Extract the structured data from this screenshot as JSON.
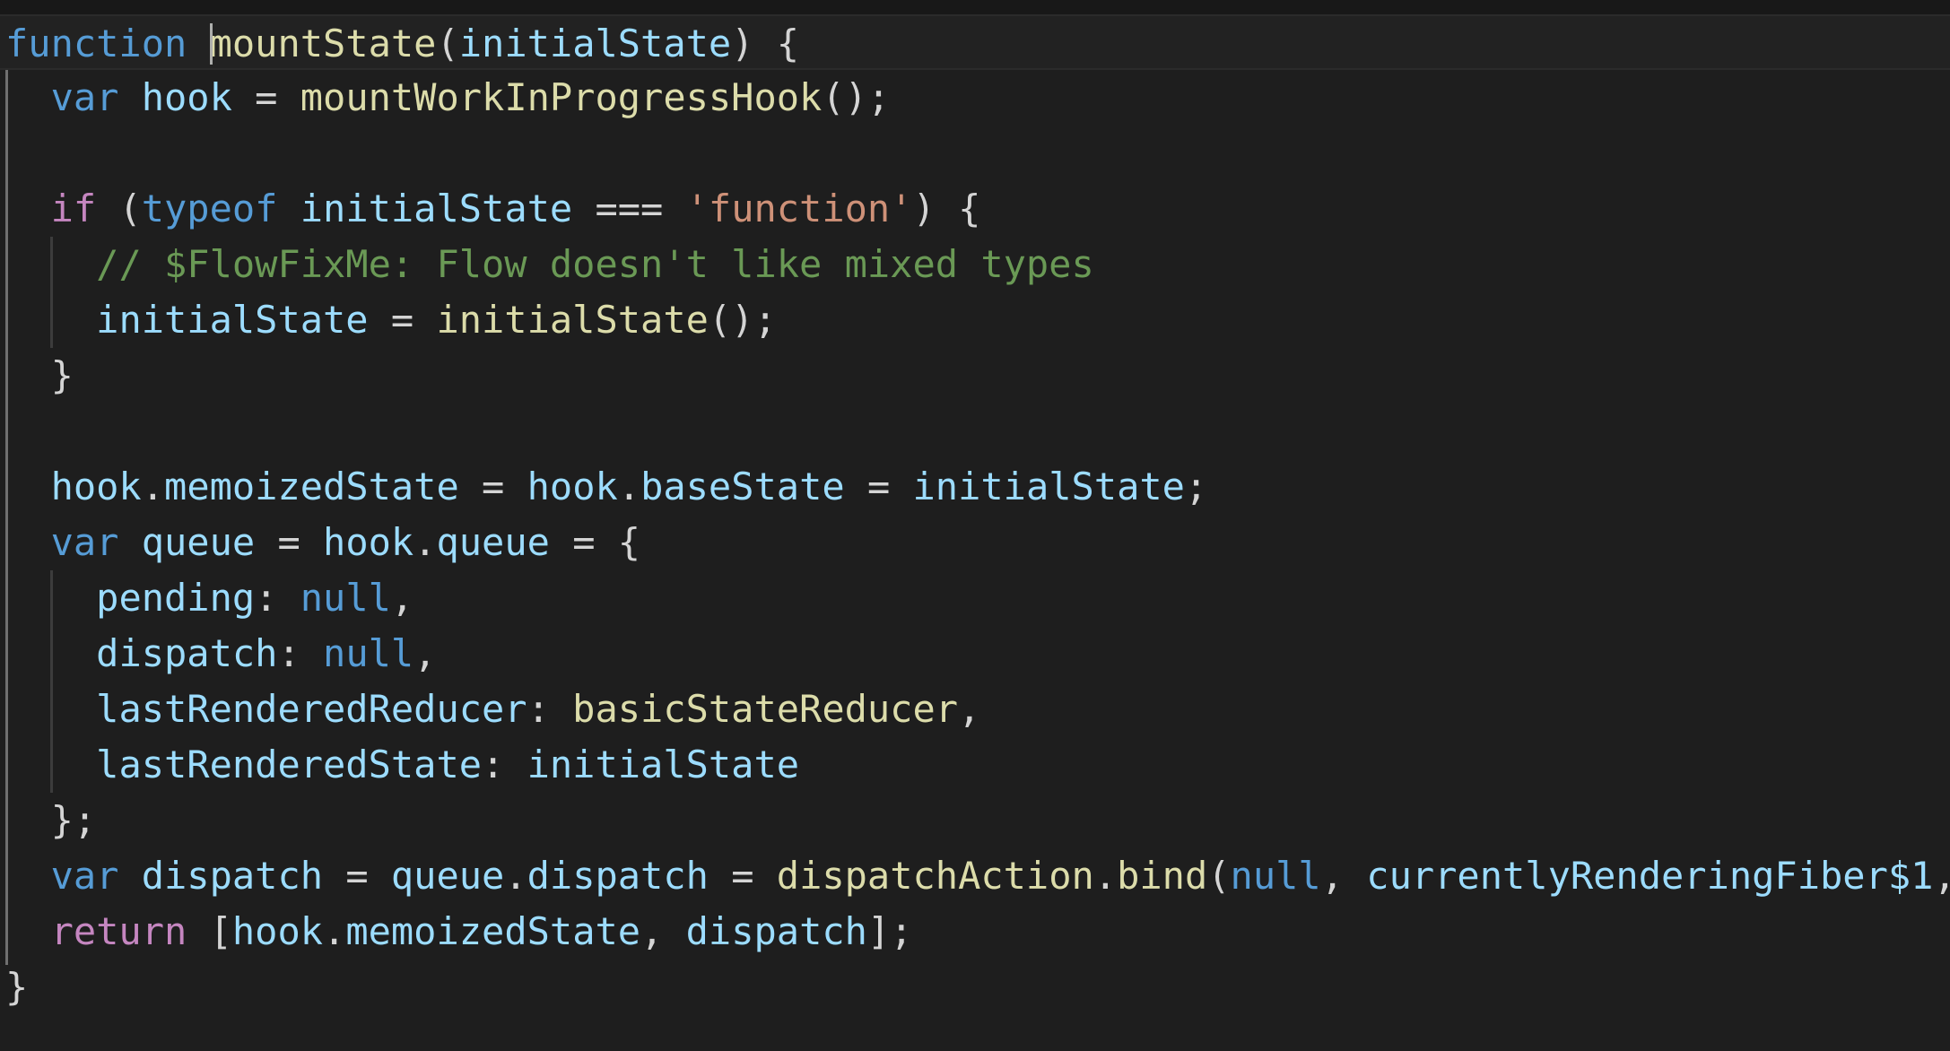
{
  "editor": {
    "theme_colors": {
      "background": "#1e1e1e",
      "keyword": "#569cd6",
      "control": "#c586c0",
      "function": "#dcdcaa",
      "variable": "#9cdcfe",
      "string": "#ce9178",
      "comment": "#6a9955",
      "punctuation": "#d4d4d4"
    },
    "lines": [
      {
        "tokens": [
          {
            "t": "function",
            "c": "kw"
          },
          {
            "t": " ",
            "c": "pun"
          },
          {
            "t": "",
            "c": "cursor"
          },
          {
            "t": "mountState",
            "c": "fn"
          },
          {
            "t": "(",
            "c": "pun"
          },
          {
            "t": "initialState",
            "c": "var"
          },
          {
            "t": ") {",
            "c": "pun"
          }
        ]
      },
      {
        "tokens": [
          {
            "t": "  ",
            "c": "pun"
          },
          {
            "t": "var",
            "c": "kw"
          },
          {
            "t": " ",
            "c": "pun"
          },
          {
            "t": "hook",
            "c": "var"
          },
          {
            "t": " = ",
            "c": "pun"
          },
          {
            "t": "mountWorkInProgressHook",
            "c": "fn"
          },
          {
            "t": "();",
            "c": "pun"
          }
        ]
      },
      {
        "tokens": []
      },
      {
        "tokens": [
          {
            "t": "  ",
            "c": "pun"
          },
          {
            "t": "if",
            "c": "ctl"
          },
          {
            "t": " (",
            "c": "pun"
          },
          {
            "t": "typeof",
            "c": "kw"
          },
          {
            "t": " ",
            "c": "pun"
          },
          {
            "t": "initialState",
            "c": "var"
          },
          {
            "t": " === ",
            "c": "pun"
          },
          {
            "t": "'function'",
            "c": "str"
          },
          {
            "t": ") {",
            "c": "pun"
          }
        ]
      },
      {
        "tokens": [
          {
            "t": "    ",
            "c": "pun"
          },
          {
            "t": "// $FlowFixMe: Flow doesn't like mixed types",
            "c": "cmt"
          }
        ]
      },
      {
        "tokens": [
          {
            "t": "    ",
            "c": "pun"
          },
          {
            "t": "initialState",
            "c": "var"
          },
          {
            "t": " = ",
            "c": "pun"
          },
          {
            "t": "initialState",
            "c": "fn"
          },
          {
            "t": "();",
            "c": "pun"
          }
        ]
      },
      {
        "tokens": [
          {
            "t": "  }",
            "c": "pun"
          }
        ]
      },
      {
        "tokens": []
      },
      {
        "tokens": [
          {
            "t": "  ",
            "c": "pun"
          },
          {
            "t": "hook",
            "c": "var"
          },
          {
            "t": ".",
            "c": "pun"
          },
          {
            "t": "memoizedState",
            "c": "var"
          },
          {
            "t": " = ",
            "c": "pun"
          },
          {
            "t": "hook",
            "c": "var"
          },
          {
            "t": ".",
            "c": "pun"
          },
          {
            "t": "baseState",
            "c": "var"
          },
          {
            "t": " = ",
            "c": "pun"
          },
          {
            "t": "initialState",
            "c": "var"
          },
          {
            "t": ";",
            "c": "pun"
          }
        ]
      },
      {
        "tokens": [
          {
            "t": "  ",
            "c": "pun"
          },
          {
            "t": "var",
            "c": "kw"
          },
          {
            "t": " ",
            "c": "pun"
          },
          {
            "t": "queue",
            "c": "var"
          },
          {
            "t": " = ",
            "c": "pun"
          },
          {
            "t": "hook",
            "c": "var"
          },
          {
            "t": ".",
            "c": "pun"
          },
          {
            "t": "queue",
            "c": "var"
          },
          {
            "t": " = {",
            "c": "pun"
          }
        ]
      },
      {
        "tokens": [
          {
            "t": "    ",
            "c": "pun"
          },
          {
            "t": "pending",
            "c": "var"
          },
          {
            "t": ": ",
            "c": "pun"
          },
          {
            "t": "null",
            "c": "kw"
          },
          {
            "t": ",",
            "c": "pun"
          }
        ]
      },
      {
        "tokens": [
          {
            "t": "    ",
            "c": "pun"
          },
          {
            "t": "dispatch",
            "c": "var"
          },
          {
            "t": ": ",
            "c": "pun"
          },
          {
            "t": "null",
            "c": "kw"
          },
          {
            "t": ",",
            "c": "pun"
          }
        ]
      },
      {
        "tokens": [
          {
            "t": "    ",
            "c": "pun"
          },
          {
            "t": "lastRenderedReducer",
            "c": "var"
          },
          {
            "t": ": ",
            "c": "pun"
          },
          {
            "t": "basicStateReducer",
            "c": "fn"
          },
          {
            "t": ",",
            "c": "pun"
          }
        ]
      },
      {
        "tokens": [
          {
            "t": "    ",
            "c": "pun"
          },
          {
            "t": "lastRenderedState",
            "c": "var"
          },
          {
            "t": ": ",
            "c": "pun"
          },
          {
            "t": "initialState",
            "c": "var"
          }
        ]
      },
      {
        "tokens": [
          {
            "t": "  };",
            "c": "pun"
          }
        ]
      },
      {
        "tokens": [
          {
            "t": "  ",
            "c": "pun"
          },
          {
            "t": "var",
            "c": "kw"
          },
          {
            "t": " ",
            "c": "pun"
          },
          {
            "t": "dispatch",
            "c": "var"
          },
          {
            "t": " = ",
            "c": "pun"
          },
          {
            "t": "queue",
            "c": "var"
          },
          {
            "t": ".",
            "c": "pun"
          },
          {
            "t": "dispatch",
            "c": "var"
          },
          {
            "t": " = ",
            "c": "pun"
          },
          {
            "t": "dispatchAction",
            "c": "fn"
          },
          {
            "t": ".",
            "c": "pun"
          },
          {
            "t": "bind",
            "c": "fn"
          },
          {
            "t": "(",
            "c": "pun"
          },
          {
            "t": "null",
            "c": "kw"
          },
          {
            "t": ", ",
            "c": "pun"
          },
          {
            "t": "currentlyRenderingFiber$1",
            "c": "var"
          },
          {
            "t": ",",
            "c": "pun"
          }
        ]
      },
      {
        "tokens": [
          {
            "t": "  ",
            "c": "pun"
          },
          {
            "t": "return",
            "c": "ctl"
          },
          {
            "t": " [",
            "c": "pun"
          },
          {
            "t": "hook",
            "c": "var"
          },
          {
            "t": ".",
            "c": "pun"
          },
          {
            "t": "memoizedState",
            "c": "var"
          },
          {
            "t": ", ",
            "c": "pun"
          },
          {
            "t": "dispatch",
            "c": "var"
          },
          {
            "t": "];",
            "c": "pun"
          }
        ]
      },
      {
        "tokens": [
          {
            "t": "}",
            "c": "pun"
          }
        ]
      }
    ]
  }
}
